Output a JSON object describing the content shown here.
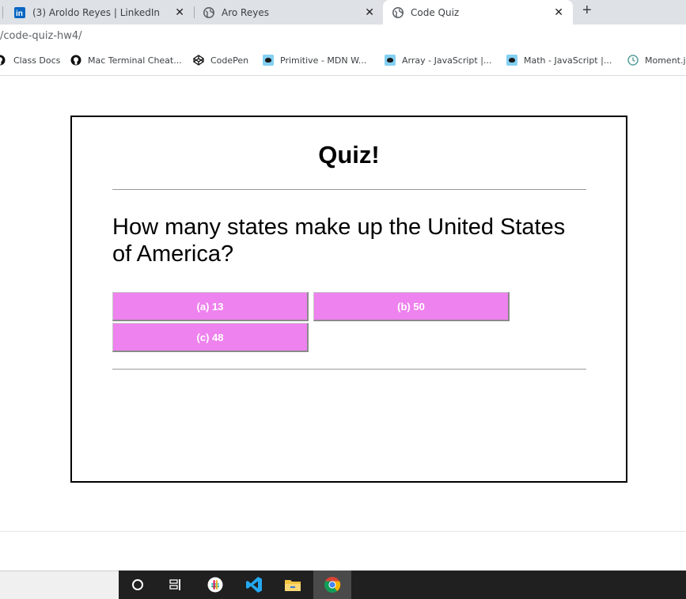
{
  "browser": {
    "tabs": [
      {
        "title": "(3) Aroldo Reyes | LinkedIn",
        "icon": "linkedin-icon",
        "active": false
      },
      {
        "title": "Aro Reyes",
        "icon": "globe-icon",
        "active": false
      },
      {
        "title": "Code Quiz",
        "icon": "globe-icon",
        "active": true
      }
    ],
    "close_glyph": "✕",
    "new_tab_glyph": "+",
    "url": "/code-quiz-hw4/",
    "bookmarks": [
      {
        "label": "Class Docs",
        "icon": "github-icon"
      },
      {
        "label": "Mac Terminal Cheat...",
        "icon": "github-icon"
      },
      {
        "label": "CodePen",
        "icon": "codepen-icon"
      },
      {
        "label": "Primitive - MDN W...",
        "icon": "mdn-icon"
      },
      {
        "label": "Array - JavaScript |...",
        "icon": "mdn-icon"
      },
      {
        "label": "Math - JavaScript |...",
        "icon": "mdn-icon"
      },
      {
        "label": "Moment.js",
        "icon": "clock-icon"
      }
    ]
  },
  "quiz": {
    "title": "Quiz!",
    "question": "How many states make up the United States of America?",
    "answers": [
      "(a) 13",
      "(b) 50",
      "(c) 48"
    ],
    "answer_color": "#ee82ee"
  },
  "taskbar": {
    "icons": [
      "search-icon",
      "task-view-icon",
      "slack-icon",
      "vscode-icon",
      "file-explorer-icon",
      "chrome-icon"
    ]
  }
}
